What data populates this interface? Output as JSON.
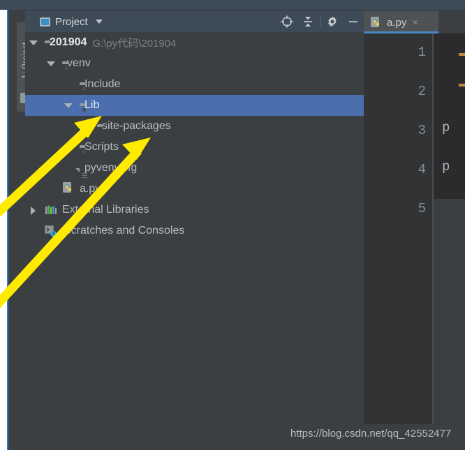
{
  "window": {
    "menu_strip_text": "",
    "background_color": "#3c3f41"
  },
  "left_tool_bar": {
    "tab_number": "1:",
    "tab_label": " Project",
    "folder_icon_name": "folder-icon"
  },
  "project_panel": {
    "title": "Project",
    "header_color": "#3c4b57",
    "actions": [
      {
        "name": "locate-icon",
        "tooltip": "Select Opened File"
      },
      {
        "name": "collapse-all-icon",
        "tooltip": "Collapse All"
      },
      {
        "name": "settings-gear-icon",
        "tooltip": "Settings"
      },
      {
        "name": "hide-icon",
        "tooltip": "Hide"
      }
    ],
    "selection_color": "#4b6eaf",
    "tree": [
      {
        "label": "201904",
        "sublabel": "G:\\py代码\\201904",
        "icon": "folder-icon",
        "twisty": "open",
        "indent": 0,
        "bold": true,
        "selected": false
      },
      {
        "label": "venv",
        "sublabel": "",
        "icon": "folder-excluded-icon",
        "twisty": "open",
        "indent": 1,
        "bold": false,
        "selected": false
      },
      {
        "label": "Include",
        "sublabel": "",
        "icon": "folder-excluded-icon",
        "twisty": "none",
        "indent": 2,
        "bold": false,
        "selected": false
      },
      {
        "label": "Lib",
        "sublabel": "",
        "icon": "folder-excluded-icon",
        "twisty": "open",
        "indent": 2,
        "bold": false,
        "selected": true
      },
      {
        "label": "site-packages",
        "sublabel": "",
        "icon": "folder-icon",
        "twisty": "none",
        "indent": 3,
        "bold": false,
        "selected": false
      },
      {
        "label": "Scripts",
        "sublabel": "",
        "icon": "folder-excluded-icon",
        "twisty": "none",
        "indent": 2,
        "bold": false,
        "selected": false
      },
      {
        "label": "pyvenv.cfg",
        "sublabel": "",
        "icon": "config-file-icon",
        "twisty": "none",
        "indent": 2,
        "bold": false,
        "selected": false
      },
      {
        "label": "a.py",
        "sublabel": "",
        "icon": "python-file-icon",
        "twisty": "none",
        "indent": 1,
        "bold": false,
        "selected": false
      },
      {
        "label": "External Libraries",
        "sublabel": "",
        "icon": "external-libraries-icon",
        "twisty": "closed",
        "indent": 0,
        "bold": false,
        "selected": false
      },
      {
        "label": "Scratches and Consoles",
        "sublabel": "",
        "icon": "scratches-icon",
        "twisty": "none",
        "indent": 0,
        "bold": false,
        "selected": false
      }
    ]
  },
  "editor": {
    "tab": {
      "label": "a.py",
      "icon": "python-file-icon",
      "close_label": "×",
      "active_underline_color": "#4a88c7"
    },
    "line_numbers": [
      "1",
      "2",
      "3",
      "4",
      "5"
    ],
    "code_fragments": [
      {
        "text": "p",
        "color": "#a9b7c6",
        "line": 3
      },
      {
        "text": "p",
        "color": "#a9b7c6",
        "line": 4
      }
    ],
    "background_color": "#2b2b2b",
    "gutter_color": "#313335"
  },
  "watermark": {
    "text": "https://blog.csdn.net/qq_42552477"
  },
  "annotations": {
    "arrow_color": "#ffeb00",
    "arrows": [
      {
        "name": "arrow-to-lib",
        "target": "Lib"
      },
      {
        "name": "arrow-to-site-packages",
        "target": "site-packages"
      }
    ]
  }
}
